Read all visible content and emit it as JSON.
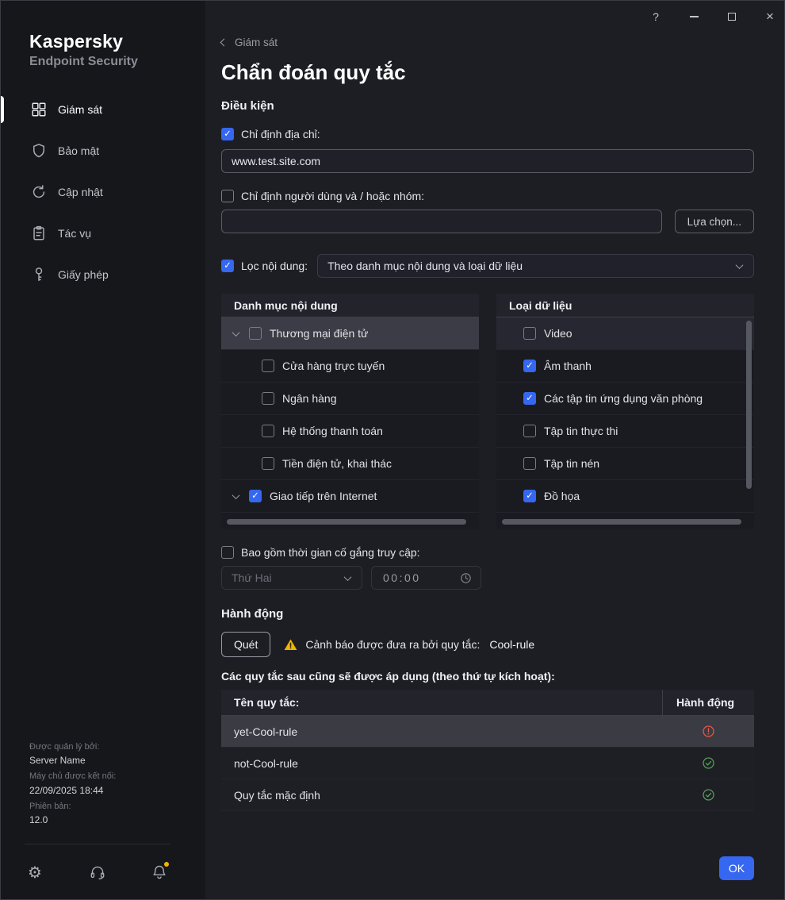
{
  "window": {
    "controls": {
      "help": "?",
      "close": "×"
    }
  },
  "colors": {
    "accent_blue": "#3567f0",
    "selection_gray": "#3b3c45",
    "warning_yellow": "#f0b400",
    "error_red": "#e05a4e",
    "success_green": "#53a058"
  },
  "sidebar": {
    "brand_line1": "Kaspersky",
    "brand_line2": "Endpoint Security",
    "items": [
      {
        "label": "Giám sát",
        "icon": "monitoring-grid-icon",
        "active": true
      },
      {
        "label": "Bảo mật",
        "icon": "shield-icon",
        "active": false
      },
      {
        "label": "Cập nhật",
        "icon": "refresh-icon",
        "active": false
      },
      {
        "label": "Tác vụ",
        "icon": "clipboard-icon",
        "active": false
      },
      {
        "label": "Giấy phép",
        "icon": "key-icon",
        "active": false
      }
    ],
    "info": {
      "managed_by_label": "Được quản lý bởi:",
      "managed_by_value": "Server Name",
      "connected_label": "Máy chủ được kết nối:",
      "connected_value": "22/09/2025 18:44",
      "version_label": "Phiên bản:",
      "version_value": "12.0"
    }
  },
  "main": {
    "back_label": "Giám sát",
    "title": "Chẩn đoán quy tắc",
    "conditions_heading": "Điều kiện",
    "address": {
      "label": "Chỉ định địa chỉ:",
      "checked": true,
      "value": "www.test.site.com"
    },
    "users": {
      "label": "Chỉ định người dùng và / hoặc nhóm:",
      "checked": false,
      "value": "",
      "select_button": "Lựa chọn..."
    },
    "filter": {
      "label": "Lọc nội dung:",
      "checked": true,
      "selected_option": "Theo danh mục nội dung và loại dữ liệu"
    },
    "category_panel": {
      "header": "Danh mục nội dung",
      "rows": [
        {
          "label": "Thương mại điện tử",
          "checked": false,
          "expanded": true,
          "selected": true,
          "indent": false
        },
        {
          "label": "Cửa hàng trực tuyến",
          "checked": false,
          "indent": true
        },
        {
          "label": "Ngân hàng",
          "checked": false,
          "indent": true
        },
        {
          "label": "Hệ thống thanh toán",
          "checked": false,
          "indent": true
        },
        {
          "label": "Tiền điện tử, khai thác",
          "checked": false,
          "indent": true
        },
        {
          "label": "Giao tiếp trên Internet",
          "checked": true,
          "expanded": true,
          "indent": false
        }
      ]
    },
    "datatype_panel": {
      "header": "Loại dữ liệu",
      "rows": [
        {
          "label": "Video",
          "checked": false,
          "highlighted": true
        },
        {
          "label": "Âm thanh",
          "checked": true
        },
        {
          "label": "Các tập tin ứng dụng văn phòng",
          "checked": true
        },
        {
          "label": "Tập tin thực thi",
          "checked": false
        },
        {
          "label": "Tập tin nén",
          "checked": false
        },
        {
          "label": "Đồ họa",
          "checked": true
        }
      ]
    },
    "time_filter": {
      "label": "Bao gồm thời gian cố gắng truy cập:",
      "checked": false,
      "day_value": "Thứ Hai",
      "time_value": "00:00"
    },
    "action_heading": "Hành động",
    "action": {
      "scan_button": "Quét",
      "warning_label": "Cảnh báo được đưa ra bởi quy tắc:",
      "rule_name": "Cool-rule"
    },
    "rules": {
      "caption": "Các quy tắc sau cũng sẽ được áp dụng (theo thứ tự kích hoạt):",
      "columns": {
        "name": "Tên quy tắc:",
        "action": "Hành động"
      },
      "rows": [
        {
          "name": "yet-Cool-rule",
          "status": "error",
          "selected": true
        },
        {
          "name": "not-Cool-rule",
          "status": "ok",
          "selected": false
        },
        {
          "name": "Quy tắc mặc định",
          "status": "ok",
          "selected": false
        }
      ]
    },
    "ok_button": "OK"
  }
}
